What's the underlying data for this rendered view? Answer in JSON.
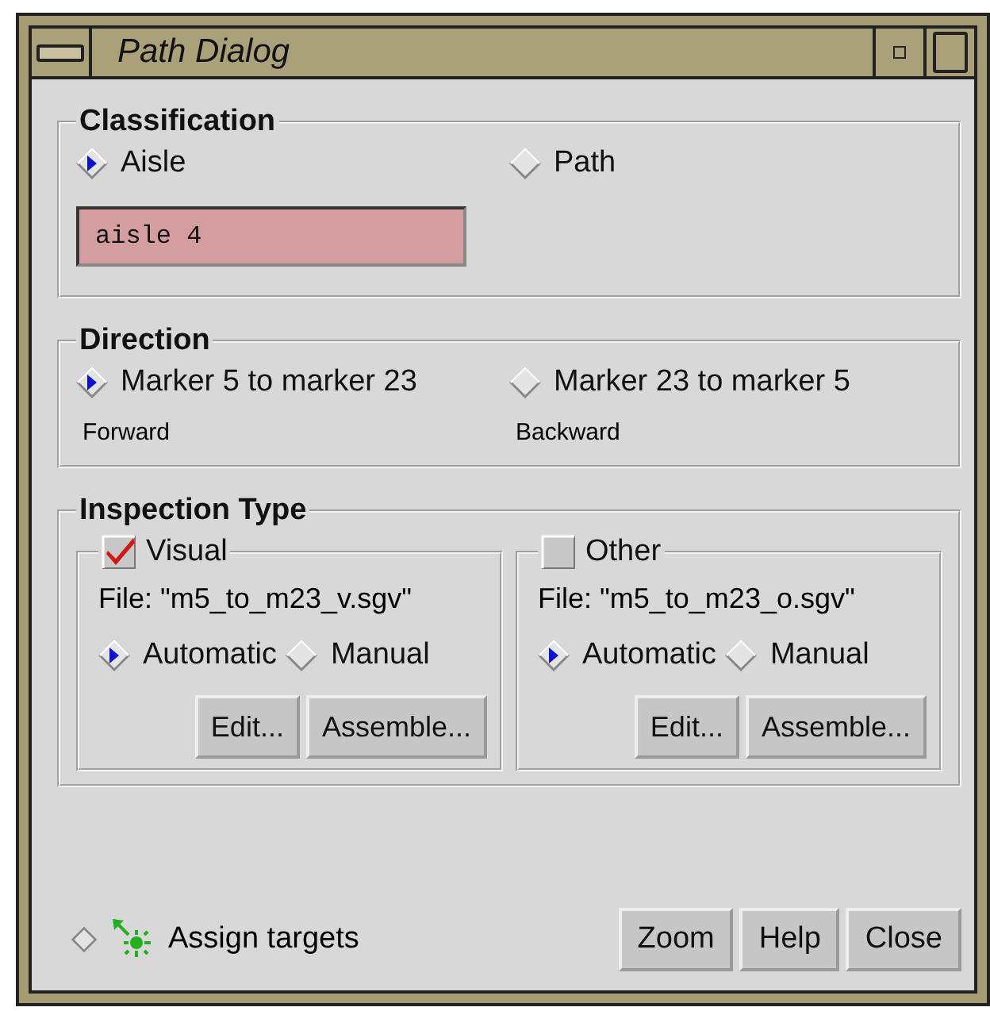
{
  "window": {
    "title": "Path Dialog"
  },
  "classification": {
    "title": "Classification",
    "options": [
      {
        "label": "Aisle",
        "selected": true
      },
      {
        "label": "Path",
        "selected": false
      }
    ],
    "field": {
      "value": "aisle 4"
    }
  },
  "direction": {
    "title": "Direction",
    "options": [
      {
        "label": "Marker 5 to marker 23",
        "caption": "Forward",
        "selected": true
      },
      {
        "label": "Marker 23 to marker 5",
        "caption": "Backward",
        "selected": false
      }
    ]
  },
  "inspection": {
    "title": "Inspection Type",
    "panels": [
      {
        "label": "Visual",
        "checked": true,
        "file": "File: \"m5_to_m23_v.sgv\"",
        "modes": [
          {
            "label": "Automatic",
            "selected": true
          },
          {
            "label": "Manual",
            "selected": false
          }
        ],
        "buttons": [
          "Edit...",
          "Assemble..."
        ]
      },
      {
        "label": "Other",
        "checked": false,
        "file": "File: \"m5_to_m23_o.sgv\"",
        "modes": [
          {
            "label": "Automatic",
            "selected": true
          },
          {
            "label": "Manual",
            "selected": false
          }
        ],
        "buttons": [
          "Edit...",
          "Assemble..."
        ]
      }
    ]
  },
  "assign": {
    "label": "Assign targets",
    "selected": false
  },
  "buttons": [
    "Zoom",
    "Help",
    "Close"
  ]
}
